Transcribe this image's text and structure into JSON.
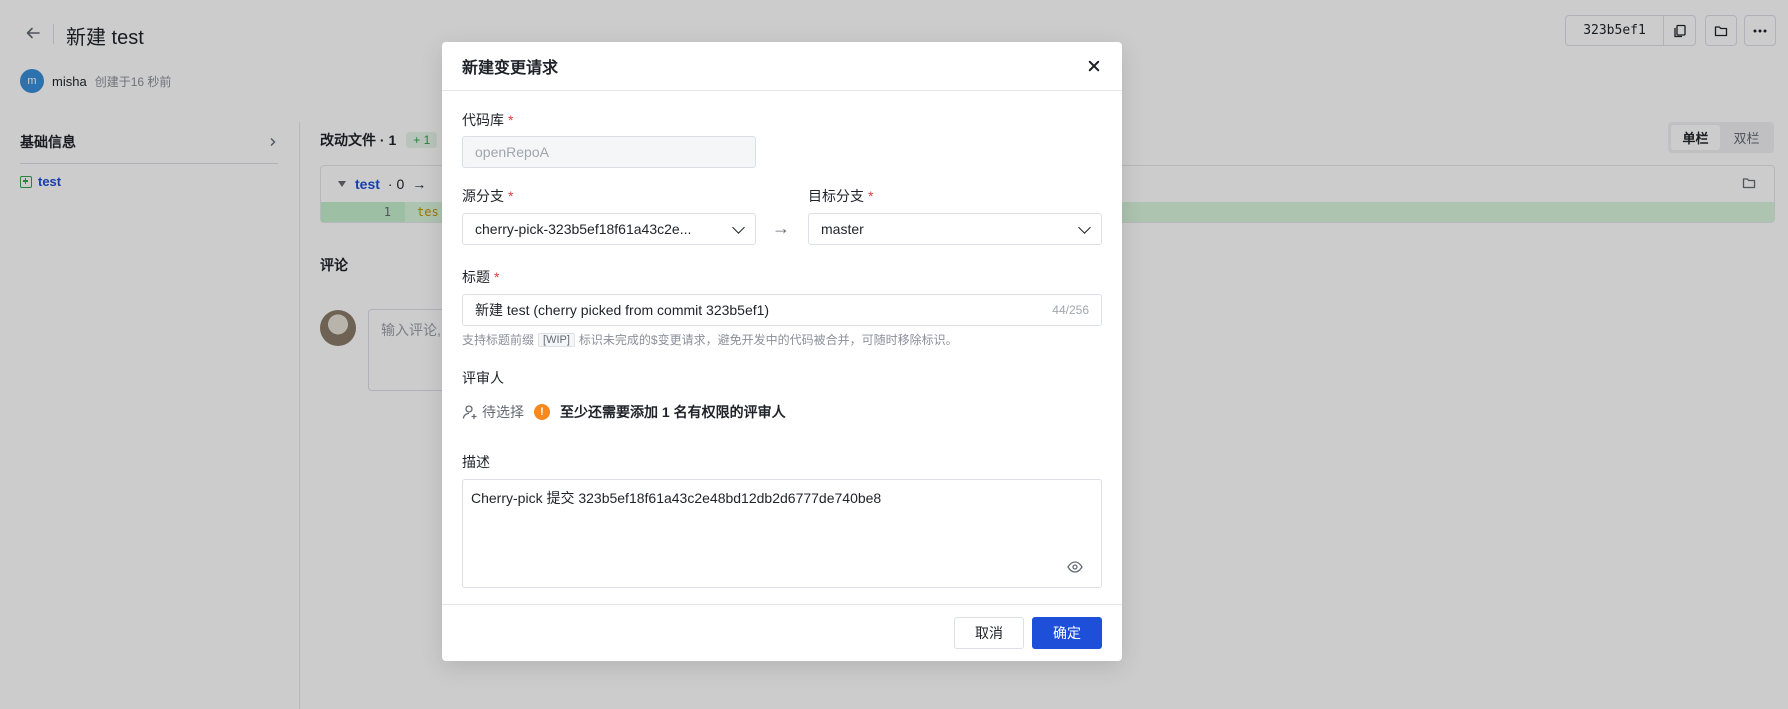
{
  "page": {
    "title": "新建 test",
    "user_initial": "m",
    "user": "misha",
    "created": "创建于16 秒前",
    "commit": "323b5ef1",
    "sidebar_title": "基础信息",
    "sidebar_file": "test",
    "changed_files": "改动文件 · 1",
    "added_badge": "+ 1",
    "view_single": "单栏",
    "view_double": "双栏",
    "file_name": "test",
    "file_stat": "· 0",
    "file_arrow": "→",
    "diff_line_no": "1",
    "diff_code": "tes",
    "comment_title": "评论",
    "comment_placeholder": "输入评论,"
  },
  "modal": {
    "title": "新建变更请求",
    "repo_label": "代码库",
    "repo_value": "openRepoA",
    "source_label": "源分支",
    "source_value": "cherry-pick-323b5ef18f61a43c2e...",
    "target_label": "目标分支",
    "target_value": "master",
    "arrow": "→",
    "required_mark": "*",
    "title_label": "标题",
    "title_value": "新建 test (cherry picked from commit 323b5ef1)",
    "title_counter": "44/256",
    "hint_prefix": "支持标题前缀",
    "hint_tag": "[WIP]",
    "hint_suffix": "标识未完成的$变更请求，避免开发中的代码被合并，可随时移除标识。",
    "reviewer_label": "评审人",
    "reviewer_pending": "待选择",
    "reviewer_warning_icon": "!",
    "reviewer_warning": "至少还需要添加 1 名有权限的评审人",
    "desc_label": "描述",
    "desc_value": "Cherry-pick 提交 323b5ef18f61a43c2e48bd12db2d6777de740be8",
    "cancel_label": "取消",
    "ok_label": "确定"
  },
  "colors": {
    "primary": "#1e4fd8",
    "required": "#e0393e",
    "warning": "#f5891f",
    "diff_added": "#d8f5dc"
  }
}
